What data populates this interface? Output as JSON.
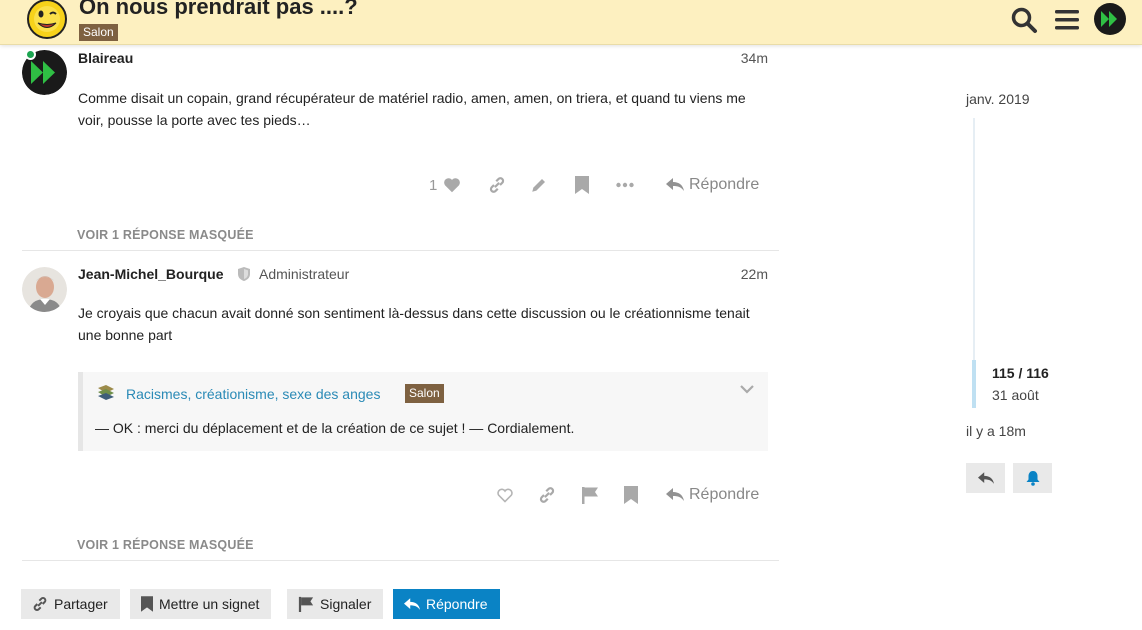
{
  "header": {
    "title": "On nous prendrait pas ....?",
    "category": "Salon"
  },
  "posts": [
    {
      "username": "Blaireau",
      "role": "",
      "age": "34m",
      "body": "Comme disait un copain, grand récupérateur de matériel radio, amen, amen, on triera, et quand tu viens me voir, pousse la porte avec tes pieds…",
      "like_count": "1",
      "reply_label": "Répondre",
      "hidden_replies": "VOIR 1 RÉPONSE MASQUÉE"
    },
    {
      "username": "Jean-Michel_Bourque",
      "role": "Administrateur",
      "age": "22m",
      "body": "Je croyais que chacun avait donné son sentiment là-dessus dans cette discussion ou le créationnisme tenait une bonne part",
      "quote": {
        "title": "Racismes, créationisme, sexe des anges",
        "category": "Salon",
        "text": "— OK : merci du déplacement et de la création de ce sujet ! — Cordialement."
      },
      "reply_label": "Répondre",
      "hidden_replies": "VOIR 1 RÉPONSE MASQUÉE"
    }
  ],
  "footer_buttons": {
    "share": "Partager",
    "bookmark": "Mettre un signet",
    "flag": "Signaler",
    "reply": "Répondre"
  },
  "timeline": {
    "start": "janv. 2019",
    "position": "115 / 116",
    "date": "31 août",
    "end": "il y a 18m"
  },
  "colors": {
    "header_bg": "#fdf0c0",
    "category_badge": "#7e6141",
    "primary_button": "#0a83c5",
    "link": "#2a8ab6",
    "online": "#1ca551"
  }
}
